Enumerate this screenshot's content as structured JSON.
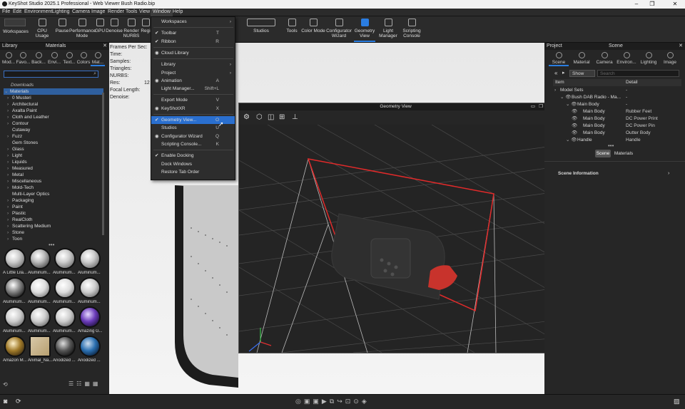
{
  "title": "KeyShot Studio 2025.1 Professional  -  Web Viewer Bush Radio.bip",
  "menu": [
    "File",
    "Edit",
    "Environment",
    "Lighting",
    "Camera",
    "Image",
    "Render",
    "Tools",
    "View",
    "Window",
    "Help"
  ],
  "ribbon_left": [
    {
      "label": "Workspaces"
    },
    {
      "label": "CPU Usage"
    },
    {
      "label": "Pause"
    },
    {
      "label": "Performance Mode"
    },
    {
      "label": "GPU"
    },
    {
      "label": "Denoise"
    },
    {
      "label": "Render NURBS"
    },
    {
      "label": "Regi"
    }
  ],
  "ribbon_right": [
    {
      "label": "Studios"
    },
    {
      "label": "Tools"
    },
    {
      "label": "Color Mode"
    },
    {
      "label": "Configurator Wizard"
    },
    {
      "label": "Geometry View",
      "selected": true
    },
    {
      "label": "Light Manager"
    },
    {
      "label": "Scripting Console"
    }
  ],
  "window_menu": [
    {
      "label": "Workspaces",
      "arrow": true
    },
    {
      "sep": true
    },
    {
      "label": "Toolbar",
      "shortcut": "T",
      "checked": true
    },
    {
      "label": "Ribbon",
      "shortcut": "R",
      "checked": true
    },
    {
      "sep": true
    },
    {
      "label": "Cloud Library",
      "icon": true
    },
    {
      "sep": true
    },
    {
      "label": "Library",
      "arrow": true
    },
    {
      "label": "Project",
      "arrow": true
    },
    {
      "label": "Animation",
      "shortcut": "A",
      "icon": true
    },
    {
      "label": "Light Manager...",
      "shortcut": "Shift+L"
    },
    {
      "sep": true
    },
    {
      "label": "Export Mode",
      "shortcut": "V"
    },
    {
      "label": "KeyShotXR",
      "shortcut": "X",
      "icon": true
    },
    {
      "sep": true
    },
    {
      "label": "Geometry View...",
      "shortcut": "O",
      "checked": true,
      "highlight": true
    },
    {
      "label": "Studios",
      "shortcut": "U"
    },
    {
      "label": "Configurator Wizard",
      "shortcut": "Q",
      "icon": true
    },
    {
      "label": "Scripting Console...",
      "shortcut": "K"
    },
    {
      "sep": true
    },
    {
      "label": "Enable Docking",
      "checked": true
    },
    {
      "label": "Dock Windows"
    },
    {
      "label": "Restore Tab Order"
    }
  ],
  "library": {
    "title": "Library",
    "subtitle": "Materials",
    "tabs": [
      "Mod...",
      "Favo...",
      "Back...",
      "Envi...",
      "Text...",
      "Colors",
      "Mat..."
    ],
    "folder": "Downloads",
    "tree": [
      {
        "label": "Materials",
        "sel": true
      },
      {
        "label": "0 Musteri"
      },
      {
        "label": "Architectural"
      },
      {
        "label": "Axalta Paint"
      },
      {
        "label": "Cloth and Leather"
      },
      {
        "label": "Contour"
      },
      {
        "label": "Cutaway",
        "nocaret": true
      },
      {
        "label": "Fuzz"
      },
      {
        "label": "Gem Stones",
        "nocaret": true
      },
      {
        "label": "Glass"
      },
      {
        "label": "Light"
      },
      {
        "label": "Liquids"
      },
      {
        "label": "Measured"
      },
      {
        "label": "Metal"
      },
      {
        "label": "Miscellaneous"
      },
      {
        "label": "Mold-Tech"
      },
      {
        "label": "Multi-Layer Optics",
        "nocaret": true
      },
      {
        "label": "Packaging"
      },
      {
        "label": "Paint"
      },
      {
        "label": "Plastic"
      },
      {
        "label": "RealCloth"
      },
      {
        "label": "Scattering Medium"
      },
      {
        "label": "Stone"
      },
      {
        "label": "Toon"
      }
    ],
    "thumbs": [
      "A Little Lila...",
      "Aluminum...",
      "Aluminum...",
      "Aluminum...",
      "Aluminum...",
      "Aluminum...",
      "Aluminum...",
      "Aluminum...",
      "Aluminum...",
      "Aluminum...",
      "Aluminum...",
      "Amazing G...",
      "Amazon M...",
      "Animal_Na...",
      "Anodized ...",
      "Anodized ..."
    ]
  },
  "stats": {
    "labels": [
      "Frames Per Sec:",
      "Time:",
      "Samples:",
      "Triangles:",
      "NURBS:",
      "Res:",
      "Focal Length:",
      "Denoise:"
    ],
    "res_value": "12"
  },
  "geometry_view": {
    "title": "Geometry View"
  },
  "project": {
    "title": "Project",
    "subtitle": "Scene",
    "tabs": [
      "Scene",
      "Material",
      "Camera",
      "Environ...",
      "Lighting",
      "Image"
    ],
    "show_select": "Show",
    "search_placeholder": "Search",
    "columns": [
      "Item",
      "Detail"
    ],
    "rows": [
      {
        "item": "Model Sets",
        "detail": "-",
        "indent": 0
      },
      {
        "item": "Bush DAB Radio - Ma...",
        "detail": "-",
        "indent": 1
      },
      {
        "item": "Main Body",
        "detail": "-",
        "indent": 2
      },
      {
        "item": "Main Body",
        "detail": "Rubber Feet",
        "indent": 3
      },
      {
        "item": "Main Body",
        "detail": "DC Power Print",
        "indent": 3
      },
      {
        "item": "Main Body",
        "detail": "DC Power Pin",
        "indent": 3
      },
      {
        "item": "Main Body",
        "detail": "Outter Body",
        "indent": 3
      },
      {
        "item": "Handle",
        "detail": "Handle",
        "indent": 2
      }
    ],
    "subtabs": [
      "Scene",
      "Materials"
    ],
    "section": "Scene Information"
  }
}
